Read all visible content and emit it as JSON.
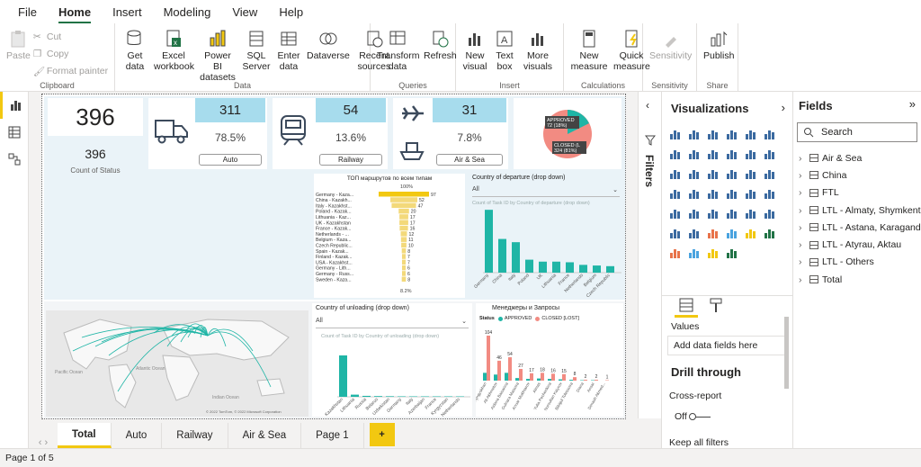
{
  "menu": {
    "file": "File",
    "home": "Home",
    "insert": "Insert",
    "modeling": "Modeling",
    "view": "View",
    "help": "Help"
  },
  "ribbon": {
    "paste": "Paste",
    "cut": "Cut",
    "copy": "Copy",
    "format_painter": "Format painter",
    "clipboard": "Clipboard",
    "get_data": "Get data",
    "excel": "Excel workbook",
    "pbi_datasets": "Power BI datasets",
    "sql": "SQL Server",
    "enter_data": "Enter data",
    "dataverse": "Dataverse",
    "recent": "Recent sources",
    "data_group": "Data",
    "transform": "Transform data",
    "refresh": "Refresh",
    "queries": "Queries",
    "new_visual": "New visual",
    "text_box": "Text box",
    "more_visuals": "More visuals",
    "insert_group": "Insert",
    "new_measure": "New measure",
    "quick_measure": "Quick measure",
    "calc_group": "Calculations",
    "sensitivity": "Sensitivity",
    "sensitivity_group": "Sensitivity",
    "publish": "Publish",
    "share": "Share"
  },
  "kpi": {
    "count_big": "396",
    "count_small": "396",
    "count_label": "Count of Status",
    "auto_value": "311",
    "auto_pct": "78.5%",
    "auto_label": "Auto",
    "rail_value": "54",
    "rail_pct": "13.6%",
    "rail_label": "Railway",
    "air_value": "31",
    "air_pct": "7.8%",
    "air_label": "Air & Sea"
  },
  "pie": {
    "approved": "APPROVED\n72 (18%)",
    "closed": "CLOSED (L\n324 (81%)"
  },
  "funnel": {
    "title": "ТОП маршрутов по всем типам",
    "top_pct": "100%",
    "bottom_pct": "8.2%",
    "rows": [
      [
        "Germany - Kaza...",
        "97"
      ],
      [
        "China - Kazakh...",
        "52"
      ],
      [
        "Italy - Kazakhst...",
        "47"
      ],
      [
        "Poland - Kazak...",
        "20"
      ],
      [
        "Lithuania - Kaz...",
        "17"
      ],
      [
        "UK - Kazakhstan",
        "17"
      ],
      [
        "France - Kazak...",
        "16"
      ],
      [
        "Netherlands - ...",
        "12"
      ],
      [
        "Belgium - Kaza...",
        "11"
      ],
      [
        "Czech Republic...",
        "10"
      ],
      [
        "Spain - Kazak...",
        "8"
      ],
      [
        "Finland - Kazak...",
        "7"
      ],
      [
        "USA - Kazakhst...",
        "7"
      ],
      [
        "Germany - Lith...",
        "6"
      ],
      [
        "Germany - Russ...",
        "6"
      ],
      [
        "Sweden - Kaza...",
        "8"
      ]
    ]
  },
  "departure": {
    "title": "Country of departure (drop down)",
    "select": "All",
    "subtitle": "Count of Task ID by Country of departure (drop down)",
    "categories": [
      "Germany",
      "China",
      "Italy",
      "Poland",
      "UK",
      "Lithuania",
      "France",
      "Netherlands",
      "Belgium",
      "Czech Republic"
    ],
    "values": [
      97,
      52,
      47,
      20,
      17,
      17,
      16,
      12,
      11,
      10
    ]
  },
  "unloading": {
    "title": "Country of unloading (drop down)",
    "select": "All",
    "subtitle": "Count of Task ID by Country of unloading (drop down)",
    "categories": [
      "Kazakhstan",
      "Lithuania",
      "Russia",
      "Belarus",
      "Uzbekistan",
      "Germany",
      "Italy",
      "Azerbaijan",
      "France",
      "Kyrgyzstan",
      "Netherlands"
    ],
    "values": [
      345,
      18,
      8,
      6,
      5,
      4,
      3,
      3,
      2,
      2,
      2
    ]
  },
  "managers": {
    "title": "Менеджеры и Запросы",
    "status": "Status",
    "approved": "APPROVED",
    "closed": "CLOSED [LOST]",
    "labels": [
      "104",
      "46",
      "54",
      "27",
      "17",
      "18",
      "16",
      "15",
      "8",
      "2",
      "2",
      "1"
    ],
    "names": [
      "Shyngyskhan",
      "Ali Akhmetov",
      "Aidana Baisarina",
      "Gulnara Maisova",
      "Anuar Mukhtarov",
      "Almas",
      "Yulia Pechenkina",
      "Nursultan Kaiyrov",
      "Bibigul Tolessova",
      "Diana",
      "Ansar",
      "Dimash Akmed..."
    ],
    "closed_vals": [
      104,
      46,
      54,
      27,
      17,
      18,
      16,
      15,
      8,
      2,
      2,
      1
    ],
    "approved_vals": [
      18,
      14,
      18,
      6,
      4,
      5,
      4,
      3,
      2,
      1,
      1,
      0
    ]
  },
  "map": {
    "pacific": "Pacific Ocean",
    "atlantic": "Atlantic Ocean",
    "indian": "Indian Ocean",
    "credit": "© 2022 TomTom, © 2022 Microsoft Corporation"
  },
  "tabs": [
    "Total",
    "Auto",
    "Railway",
    "Air & Sea",
    "Page 1"
  ],
  "add_tab": "+",
  "status": "Page 1 of 5",
  "filters": "Filters",
  "viz": {
    "title": "Visualizations",
    "values": "Values",
    "add_fields": "Add data fields here",
    "drill": "Drill through",
    "cross": "Cross-report",
    "off": "Off",
    "keep": "Keep all filters"
  },
  "fields": {
    "title": "Fields",
    "search": "Search",
    "items": [
      "Air & Sea",
      "China",
      "FTL",
      "LTL - Almaty, Shymkent",
      "LTL - Astana, Karaganda",
      "LTL - Atyrau, Aktau",
      "LTL - Others",
      "Total"
    ]
  },
  "colors": {
    "teal": "#1fb5a6",
    "pink": "#f28b82",
    "kpi_blue": "#a7dced",
    "accent": "#f2c811"
  }
}
